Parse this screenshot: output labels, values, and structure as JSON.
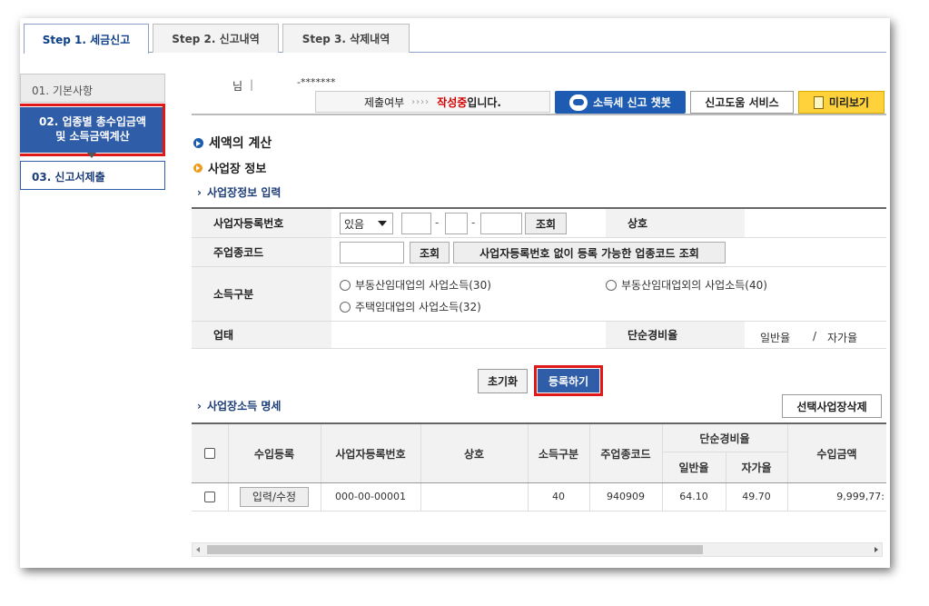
{
  "tabs": [
    {
      "label": "Step 1. 세금신고",
      "active": true
    },
    {
      "label": "Step 2. 신고내역",
      "active": false
    },
    {
      "label": "Step 3. 삭제내역",
      "active": false
    }
  ],
  "steps": [
    {
      "label": "01. 기본사항"
    },
    {
      "line1": "02. 업종별 총수입금액",
      "line2": "및 소득금액계산"
    },
    {
      "label": "03. 신고서제출"
    }
  ],
  "header": {
    "user_suffix": "님",
    "separator": "|",
    "user_id": "-*******",
    "status_label": "제출여부",
    "status_arrows": "››››",
    "status_red": "작성중",
    "status_suffix": "입니다.",
    "chatbot_label": "소득세 신고 챗봇",
    "help_label": "신고도움 서비스",
    "preview_label": "미리보기"
  },
  "sections": {
    "tax_calc": "세액의 계산",
    "business_info": "사업장 정보",
    "business_input": "사업장정보 입력",
    "income_detail": "사업장소득 명세"
  },
  "form": {
    "biz_reg_label": "사업자등록번호",
    "biz_reg_select": "있음",
    "lookup_label": "조회",
    "trade_name_label": "상호",
    "main_code_label": "주업종코드",
    "code_lookup_label": "조회",
    "no_reg_lookup_label": "사업자등록번호 없이 등록 가능한 업종코드 조회",
    "income_type_label": "소득구분",
    "radio_1": "부동산임대업의 사업소득(30)",
    "radio_2": "부동산임대업외의 사업소득(40)",
    "radio_3": "주택임대업의 사업소득(32)",
    "business_type_label": "업태",
    "simple_rate_label": "단순경비율",
    "general_rate": "일반율",
    "rate_sep": "/",
    "self_rate": "자가율"
  },
  "actions": {
    "reset": "초기화",
    "register": "등록하기",
    "delete_selected": "선택사업장삭제"
  },
  "income_table": {
    "headers": {
      "income_reg": "수입등록",
      "biz_no": "사업자등록번호",
      "trade_name": "상호",
      "income_type": "소득구분",
      "main_code": "주업종코드",
      "simple_rate": "단순경비율",
      "general": "일반율",
      "self": "자가율",
      "revenue": "수입금액"
    },
    "rows": [
      {
        "edit_label": "입력/수정",
        "biz_no": "000-00-00001",
        "trade_name": "",
        "income_type": "40",
        "main_code": "940909",
        "general": "64.10",
        "self": "49.70",
        "revenue": "9,999,77:"
      }
    ]
  }
}
